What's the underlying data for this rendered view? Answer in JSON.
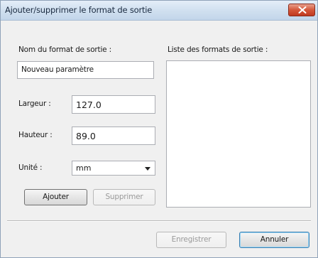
{
  "window": {
    "title": "Ajouter/supprimer le format de sortie"
  },
  "left_panel": {
    "name_label": "Nom du format de sortie :",
    "name_value": "Nouveau paramètre",
    "width_label": "Largeur :",
    "width_value": "127.0",
    "height_label": "Hauteur :",
    "height_value": "89.0",
    "unit_label": "Unité :",
    "unit_value": "mm",
    "add_button": "Ajouter",
    "delete_button": "Supprimer"
  },
  "right_panel": {
    "list_label": "Liste des formats de sortie :",
    "items": []
  },
  "footer": {
    "save_button": "Enregistrer",
    "cancel_button": "Annuler"
  }
}
